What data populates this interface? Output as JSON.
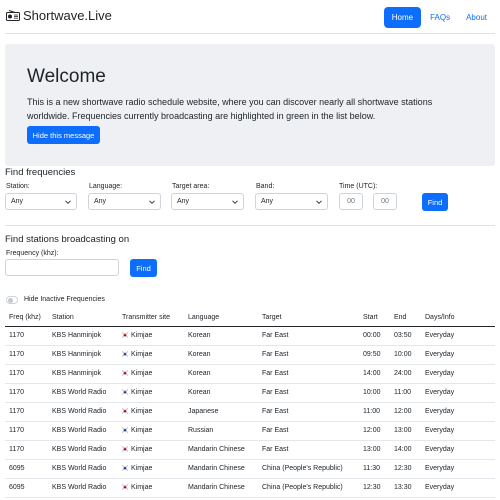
{
  "nav": {
    "brand": "Shortwave.Live",
    "links": [
      {
        "label": "Home",
        "active": true
      },
      {
        "label": "FAQs",
        "active": false
      },
      {
        "label": "About",
        "active": false
      }
    ]
  },
  "welcome": {
    "title": "Welcome",
    "text": "This is a new shortwave radio schedule website, where you can discover nearly all shortwave stations worldwide. Frequencies currently broadcasting are highlighted in green in the list below.",
    "button": "Hide this message"
  },
  "find_frequencies": {
    "title": "Find frequencies",
    "station": {
      "label": "Station:",
      "value": "Any"
    },
    "language": {
      "label": "Language:",
      "value": "Any"
    },
    "target": {
      "label": "Target area:",
      "value": "Any"
    },
    "band": {
      "label": "Band:",
      "value": "Any"
    },
    "time": {
      "label": "Time (UTC):",
      "hour_placeholder": "00",
      "minute_placeholder": "00"
    },
    "button": "Find"
  },
  "find_stations": {
    "title": "Find stations broadcasting on",
    "label": "Frequency (khz):",
    "value": "",
    "button": "Find"
  },
  "toggle": {
    "label": "Hide Inactive Frequencies",
    "checked": false
  },
  "table": {
    "headers": [
      "Freq (khz)",
      "Station",
      "Transmitter site",
      "Language",
      "Target",
      "Start",
      "End",
      "Days/Info"
    ],
    "rows": [
      [
        "1170",
        "KBS Hanminjok",
        "Kimjae",
        "Korean",
        "Far East",
        "00:00",
        "03:50",
        "Everyday"
      ],
      [
        "1170",
        "KBS Hanminjok",
        "Kimjae",
        "Korean",
        "Far East",
        "09:50",
        "10:00",
        "Everyday"
      ],
      [
        "1170",
        "KBS Hanminjok",
        "Kimjae",
        "Korean",
        "Far East",
        "14:00",
        "24:00",
        "Everyday"
      ],
      [
        "1170",
        "KBS World Radio",
        "Kimjae",
        "Korean",
        "Far East",
        "10:00",
        "11:00",
        "Everyday"
      ],
      [
        "1170",
        "KBS World Radio",
        "Kimjae",
        "Japanese",
        "Far East",
        "11:00",
        "12:00",
        "Everyday"
      ],
      [
        "1170",
        "KBS World Radio",
        "Kimjae",
        "Russian",
        "Far East",
        "12:00",
        "13:00",
        "Everyday"
      ],
      [
        "1170",
        "KBS World Radio",
        "Kimjae",
        "Mandarin Chinese",
        "Far East",
        "13:00",
        "14:00",
        "Everyday"
      ],
      [
        "6095",
        "KBS World Radio",
        "Kimjae",
        "Mandarin Chinese",
        "China (People's Republic)",
        "11:30",
        "12:30",
        "Everyday"
      ],
      [
        "6095",
        "KBS World Radio",
        "Kimjae",
        "Mandarin Chinese",
        "China (People's Republic)",
        "12:30",
        "13:30",
        "Everyday"
      ]
    ]
  },
  "icons": {
    "brand": "radio-icon",
    "chevron": "chevron-down-icon",
    "flag": "south-korea-flag-icon"
  },
  "colors": {
    "primary": "#0d6efd",
    "welcome_bg": "#eef0f3",
    "border": "#ced4da"
  }
}
